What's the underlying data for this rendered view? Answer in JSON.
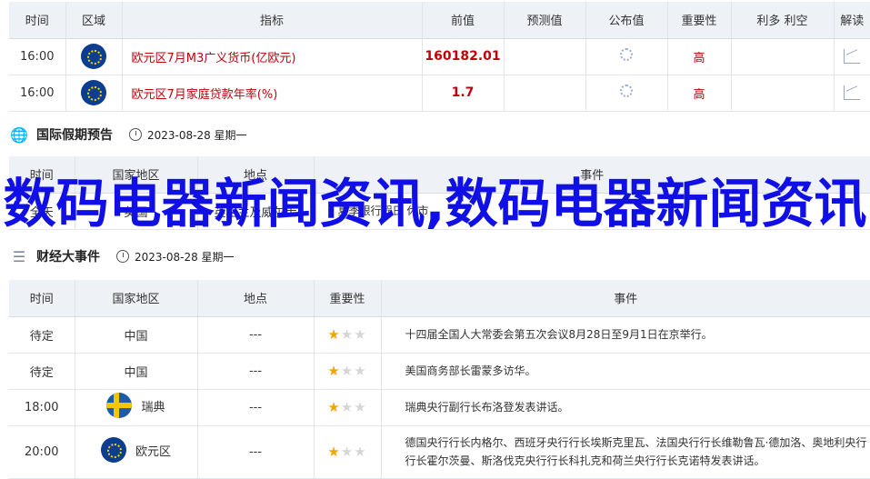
{
  "econ_table": {
    "headers": [
      "时间",
      "区域",
      "指标",
      "前值",
      "预测值",
      "公布值",
      "重要性",
      "利多 利空",
      "解读"
    ],
    "rows": [
      {
        "time": "16:00",
        "flag": "eu",
        "indicator": "欧元区7月M3广义货币(亿欧元)",
        "prev": "160182.01",
        "importance": "高"
      },
      {
        "time": "16:00",
        "flag": "eu",
        "indicator": "欧元区7月家庭贷款年率(%)",
        "prev": "1.7",
        "importance": "高"
      }
    ]
  },
  "holiday_section": {
    "title": "国际假期预告",
    "date": "2023-08-28 星期一",
    "headers": [
      "时间",
      "国家地区",
      "地点",
      "事件"
    ],
    "rows": [
      {
        "time": "全天",
        "country": "英国",
        "place": "英格兰及威尔士",
        "event": "夏季银行假日 休市"
      }
    ]
  },
  "events_section": {
    "title": "财经大事件",
    "date": "2023-08-28 星期一",
    "headers": [
      "时间",
      "国家地区",
      "地点",
      "重要性",
      "事件"
    ],
    "rows": [
      {
        "time": "待定",
        "country": "中国",
        "place": "---",
        "stars": 1,
        "event": "十四届全国人大常委会第五次会议8月28日至9月1日在京举行。"
      },
      {
        "time": "待定",
        "country": "中国",
        "place": "---",
        "stars": 1,
        "event": "美国商务部长雷蒙多访华。"
      },
      {
        "time": "18:00",
        "country": "瑞典",
        "flag": "se",
        "place": "---",
        "stars": 1,
        "event": "瑞典央行副行长布洛登发表讲话。"
      },
      {
        "time": "20:00",
        "country": "欧元区",
        "flag": "eu",
        "place": "---",
        "stars": 1,
        "event": "德国央行行长内格尔、西班牙央行行长埃斯克里瓦、法国央行行长维勒鲁瓦·德加洛、奥地利央行行长霍尔茨曼、斯洛伐克央行行长科扎克和荷兰央行行长克诺特发表讲话。"
      }
    ]
  },
  "overlay": {
    "text": "数码电器新闻资讯,数码电器新闻资讯"
  }
}
